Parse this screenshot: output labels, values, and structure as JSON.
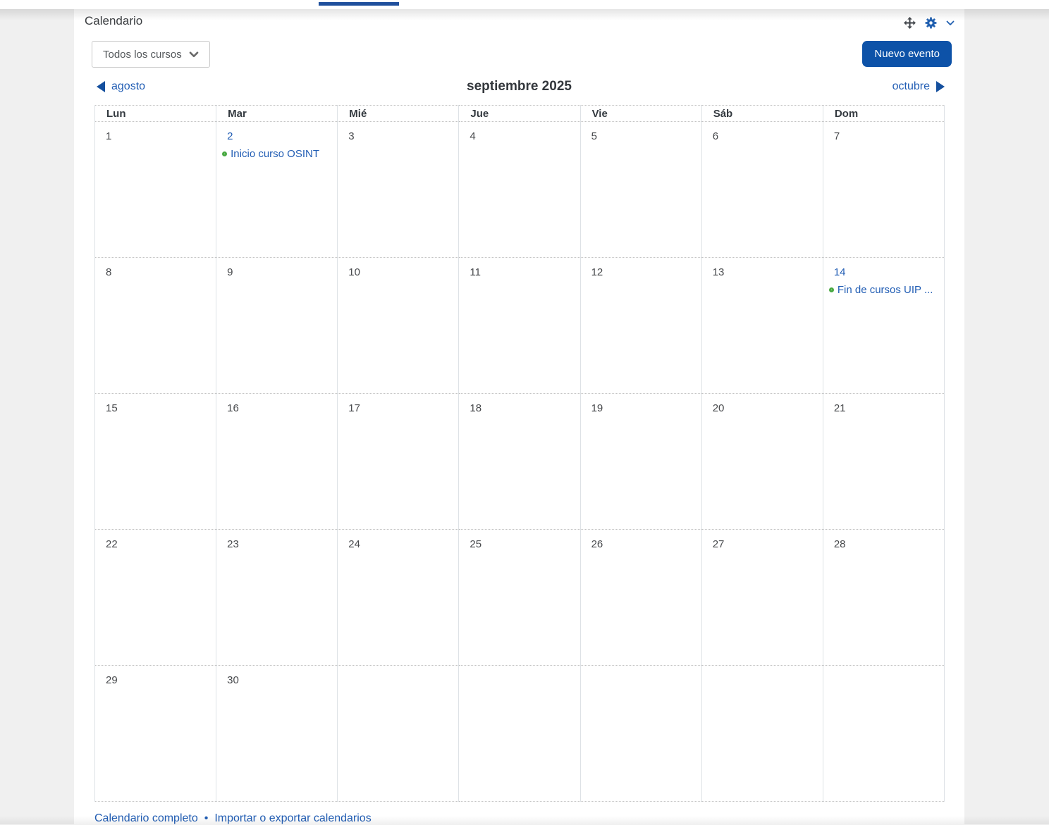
{
  "header": {
    "title": "Calendario"
  },
  "toolbar": {
    "course_filter_value": "Todos los cursos",
    "new_event_label": "Nuevo evento"
  },
  "nav": {
    "prev_month": "agosto",
    "current_month": "septiembre 2025",
    "next_month": "octubre"
  },
  "calendar": {
    "day_headers": [
      "Lun",
      "Mar",
      "Mié",
      "Jue",
      "Vie",
      "Sáb",
      "Dom"
    ],
    "weeks": [
      [
        {
          "day": "1"
        },
        {
          "day": "2",
          "has_event": true,
          "event": "Inicio curso OSINT"
        },
        {
          "day": "3"
        },
        {
          "day": "4"
        },
        {
          "day": "5"
        },
        {
          "day": "6"
        },
        {
          "day": "7"
        }
      ],
      [
        {
          "day": "8"
        },
        {
          "day": "9"
        },
        {
          "day": "10"
        },
        {
          "day": "11"
        },
        {
          "day": "12"
        },
        {
          "day": "13"
        },
        {
          "day": "14",
          "has_event": true,
          "event": "Fin de cursos UIP ..."
        }
      ],
      [
        {
          "day": "15"
        },
        {
          "day": "16"
        },
        {
          "day": "17"
        },
        {
          "day": "18"
        },
        {
          "day": "19"
        },
        {
          "day": "20"
        },
        {
          "day": "21"
        }
      ],
      [
        {
          "day": "22"
        },
        {
          "day": "23"
        },
        {
          "day": "24"
        },
        {
          "day": "25"
        },
        {
          "day": "26"
        },
        {
          "day": "27"
        },
        {
          "day": "28"
        }
      ],
      [
        {
          "day": "29"
        },
        {
          "day": "30"
        },
        {
          "day": null
        },
        {
          "day": null
        },
        {
          "day": null
        },
        {
          "day": null
        },
        {
          "day": null
        }
      ]
    ]
  },
  "footer": {
    "full_calendar": "Calendario completo",
    "separator": "•",
    "import_export": "Importar o exportar calendarios"
  },
  "colors": {
    "link": "#215db4",
    "button": "#0d52a8",
    "arrow": "#15509e",
    "accent": "#1f4f9c",
    "event_dot": "#49a942"
  }
}
